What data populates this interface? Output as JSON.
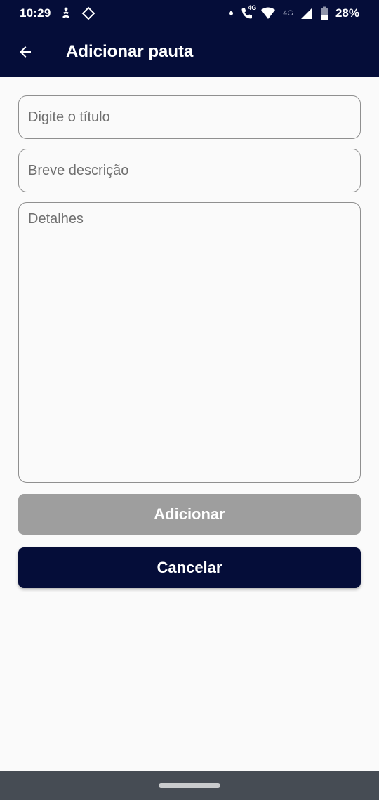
{
  "status_bar": {
    "time": "10:29",
    "network_small": "4G",
    "network_type": "4G",
    "battery": "28%",
    "icons": [
      "accessibility-icon",
      "gps-icon",
      "notification-dot-icon",
      "wifi-calling-icon",
      "wifi-icon",
      "signal-icon",
      "battery-icon"
    ]
  },
  "app_bar": {
    "title": "Adicionar pauta",
    "back_icon": "arrow-back-icon"
  },
  "form": {
    "title_placeholder": "Digite o título",
    "title_value": "",
    "description_placeholder": "Breve descrição",
    "description_value": "",
    "details_placeholder": "Detalhes",
    "details_value": ""
  },
  "buttons": {
    "add_label": "Adicionar",
    "cancel_label": "Cancelar"
  },
  "colors": {
    "primary": "#050d39",
    "disabled": "#9e9e9e",
    "background": "#fafafa",
    "nav_bar": "#464c54"
  }
}
